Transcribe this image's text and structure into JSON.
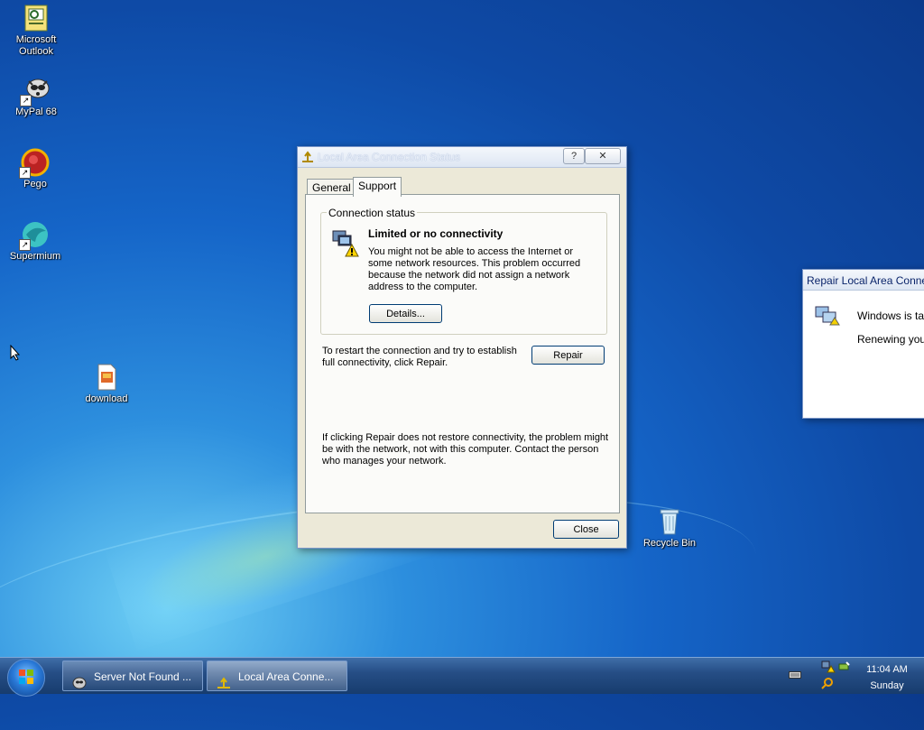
{
  "desktop": {
    "icons": [
      {
        "label": "Microsoft\nOutlook"
      },
      {
        "label": "MyPal 68"
      },
      {
        "label": "Pego"
      },
      {
        "label": "Supermium"
      },
      {
        "label": "download"
      },
      {
        "label": "Recycle Bin"
      }
    ]
  },
  "dialog": {
    "title": "Local Area Connection Status",
    "help_label": "?",
    "close_label": "✕",
    "tabs": [
      "General",
      "Support"
    ],
    "active_tab": "Support",
    "group_label": "Connection status",
    "status_title": "Limited or no connectivity",
    "status_description": "You might not be able to access the Internet or some network resources. This problem occurred because the network did not assign a network address to the computer.",
    "details_button": "Details...",
    "repair_text": "To restart the connection and try to establish full connectivity, click Repair.",
    "repair_button": "Repair",
    "footer_text": "If clicking Repair does not restore connectivity, the problem might be with the network, not with this computer. Contact the person who manages your network.",
    "close_button": "Close"
  },
  "repair_window": {
    "title": "Repair Local Area Conne",
    "line1": "Windows is taki",
    "line2": "Renewing your"
  },
  "taskbar": {
    "buttons": [
      {
        "label": "Server Not Found ..."
      },
      {
        "label": "Local Area Conne..."
      }
    ],
    "clock_time": "11:04 AM",
    "clock_day": "Sunday"
  },
  "colors": {
    "desktop_blue": "#1565c8",
    "dialog_bg": "#ece9d8",
    "button_border": "#003c74"
  }
}
